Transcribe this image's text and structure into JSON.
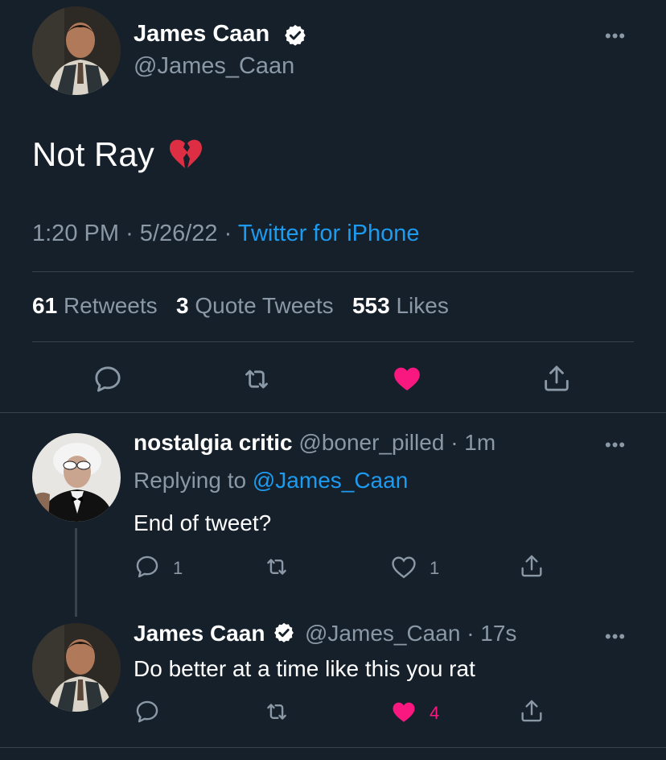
{
  "main_tweet": {
    "author_name": "James Caan",
    "handle": "@James_Caan",
    "more": "•••",
    "text": "Not Ray",
    "emoji": "💔",
    "time": "1:20 PM",
    "sep1": "·",
    "date": "5/26/22",
    "sep2": "·",
    "source": "Twitter for iPhone",
    "stats": {
      "retweets_count": "61",
      "retweets_label": "Retweets",
      "quotes_count": "3",
      "quotes_label": "Quote Tweets",
      "likes_count": "553",
      "likes_label": "Likes"
    }
  },
  "reply1": {
    "author_name": "nostalgia critic",
    "handle": "@boner_pilled",
    "time": "· 1m",
    "replying_label": "Replying to",
    "replying_handle": "@James_Caan",
    "text": "End of tweet?",
    "reply_count": "1",
    "like_count": "1",
    "more": "•••"
  },
  "reply2": {
    "author_name": "James Caan",
    "handle": "@James_Caan",
    "time": "· 17s",
    "text": "Do better at a time like this you rat",
    "like_count": "4",
    "more": "•••"
  },
  "colors": {
    "background": "#15202b",
    "accent": "#1d9bf0",
    "like": "#f91880",
    "muted": "#8b98a5"
  }
}
